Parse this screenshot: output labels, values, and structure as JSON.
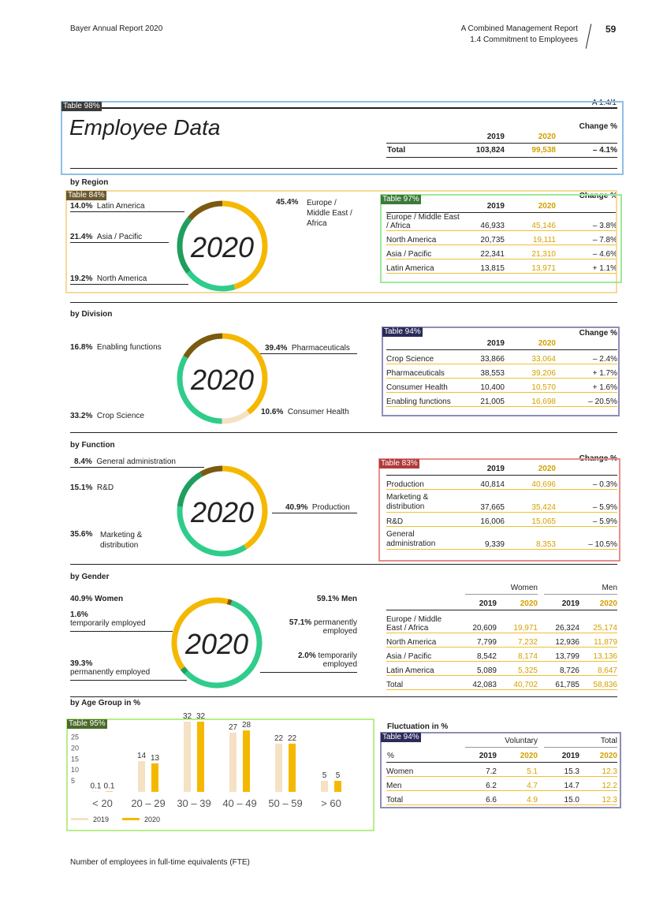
{
  "header": {
    "left": "Bayer Annual Report 2020",
    "section": "A Combined Management Report",
    "subsection": "1.4 Commitment to Employees",
    "page": "59"
  },
  "ref": "A 1.4/1",
  "annotations": {
    "a98": "Table 98%",
    "a84": "Table 84%",
    "a97": "Table 97%",
    "a94": "Table 94%",
    "a83": "Table 83%",
    "a95": "Table 95%",
    "a_fluct": "Table 94%"
  },
  "title": "Employee Data",
  "summary": {
    "headers": [
      "2019",
      "2020",
      "Change %"
    ],
    "rows": [
      [
        "Total",
        "103,824",
        "99,538",
        "– 4.1%"
      ]
    ]
  },
  "region": {
    "heading": "by Region",
    "year": "2020",
    "labels": [
      {
        "pct": "14.0%",
        "name": "Latin America"
      },
      {
        "pct": "21.4%",
        "name": "Asia / Pacific"
      },
      {
        "pct": "19.2%",
        "name": "North America"
      },
      {
        "pct": "45.4%",
        "name": "Europe / Middle East / Africa"
      }
    ],
    "table": {
      "headers": [
        "2019",
        "2020",
        "Change %"
      ],
      "rows": [
        [
          "Europe / Middle East / Africa",
          "46,933",
          "45,146",
          "– 3.8%"
        ],
        [
          "North America",
          "20,735",
          "19,111",
          "– 7.8%"
        ],
        [
          "Asia / Pacific",
          "22,341",
          "21,310",
          "– 4.6%"
        ],
        [
          "Latin America",
          "13,815",
          "13,971",
          "+ 1.1%"
        ]
      ]
    }
  },
  "division": {
    "heading": "by Division",
    "year": "2020",
    "labels": [
      {
        "pct": "16.8%",
        "name": "Enabling functions"
      },
      {
        "pct": "33.2%",
        "name": "Crop Science"
      },
      {
        "pct": "39.4%",
        "name": "Pharmaceuticals"
      },
      {
        "pct": "10.6%",
        "name": "Consumer Health"
      }
    ],
    "table": {
      "headers": [
        "2019",
        "2020",
        "Change %"
      ],
      "rows": [
        [
          "Crop Science",
          "33,866",
          "33,064",
          "– 2.4%"
        ],
        [
          "Pharmaceuticals",
          "38,553",
          "39,206",
          "+ 1.7%"
        ],
        [
          "Consumer Health",
          "10,400",
          "10,570",
          "+ 1.6%"
        ],
        [
          "Enabling functions",
          "21,005",
          "16,698",
          "– 20.5%"
        ]
      ]
    }
  },
  "function": {
    "heading": "by Function",
    "year": "2020",
    "labels": [
      {
        "pct": "8.4%",
        "name": "General administration"
      },
      {
        "pct": "15.1%",
        "name": "R&D"
      },
      {
        "pct": "35.6%",
        "name": "Marketing & distribution"
      },
      {
        "pct": "40.9%",
        "name": "Production"
      }
    ],
    "table": {
      "headers": [
        "2019",
        "2020",
        "Change %"
      ],
      "rows": [
        [
          "Production",
          "40,814",
          "40,696",
          "– 0.3%"
        ],
        [
          "Marketing & distribution",
          "37,665",
          "35,424",
          "– 5.9%"
        ],
        [
          "R&D",
          "16,006",
          "15,065",
          "– 5.9%"
        ],
        [
          "General administration",
          "9,339",
          "8,353",
          "– 10.5%"
        ]
      ]
    }
  },
  "gender": {
    "heading": "by Gender",
    "year": "2020",
    "women_label": "40.9% Women",
    "men_label": "59.1% Men",
    "labels": [
      {
        "pct": "1.6%",
        "name": "temporarily employed"
      },
      {
        "pct": "39.3%",
        "name": "permanently employed"
      },
      {
        "pct": "57.1%",
        "name": "permanently employed"
      },
      {
        "pct": "2.0%",
        "name": "temporarily employed"
      }
    ],
    "table": {
      "group_headers": [
        "Women",
        "Men"
      ],
      "headers": [
        "2019",
        "2020",
        "2019",
        "2020"
      ],
      "rows": [
        [
          "Europe / Middle East / Africa",
          "20,609",
          "19,971",
          "26,324",
          "25,174"
        ],
        [
          "North America",
          "7,799",
          "7,232",
          "12,936",
          "11,879"
        ],
        [
          "Asia / Pacific",
          "8,542",
          "8,174",
          "13,799",
          "13,136"
        ],
        [
          "Latin America",
          "5,089",
          "5,325",
          "8,726",
          "8,647"
        ],
        [
          "Total",
          "42,083",
          "40,702",
          "61,785",
          "58,836"
        ]
      ]
    }
  },
  "age": {
    "heading": "by Age Group in %",
    "chart_data": {
      "type": "bar",
      "categories": [
        "< 20",
        "20 – 29",
        "30 – 39",
        "40 – 49",
        "50 – 59",
        "> 60"
      ],
      "series": [
        {
          "name": "2019",
          "values": [
            0.1,
            14,
            32,
            27,
            22,
            5
          ],
          "color": "#f5e2c4"
        },
        {
          "name": "2020",
          "values": [
            0.1,
            13,
            32,
            28,
            22,
            5
          ],
          "color": "#f5b800"
        }
      ],
      "ytick_labels": [
        "5",
        "10",
        "15",
        "20",
        "25"
      ],
      "ylim": [
        0,
        32
      ],
      "legend": [
        "2019",
        "2020"
      ]
    }
  },
  "fluctuation": {
    "heading": "Fluctuation in %",
    "group_headers": [
      "Voluntary",
      "Total"
    ],
    "headers": [
      "%",
      "2019",
      "2020",
      "2019",
      "2020"
    ],
    "rows": [
      [
        "Women",
        "7.2",
        "5.1",
        "15.3",
        "12.3"
      ],
      [
        "Men",
        "6.2",
        "4.7",
        "14.7",
        "12.2"
      ],
      [
        "Total",
        "6.6",
        "4.9",
        "15.0",
        "12.3"
      ]
    ]
  },
  "footnote": "Number of employees in full-time equivalents (FTE)",
  "colors": {
    "gold": "#f5b800",
    "green": "#2fcc8b",
    "dark_green": "#1f9e5e",
    "brown": "#7a5a10",
    "beige": "#f5e2c4"
  }
}
